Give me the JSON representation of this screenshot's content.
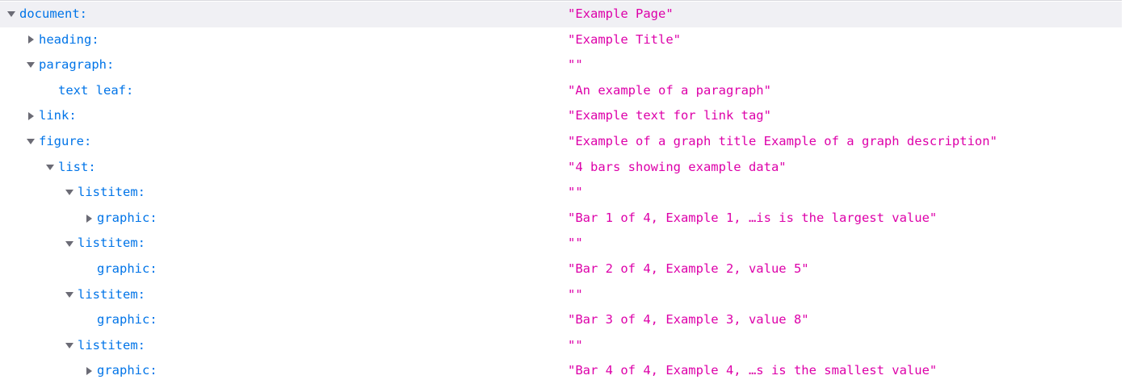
{
  "tree": {
    "rows": [
      {
        "name": "document:",
        "value": "\"Example Page\"",
        "icon": "expanded-triangle"
      },
      {
        "name": "heading:",
        "value": "\"Example Title\"",
        "icon": "collapsed-triangle"
      },
      {
        "name": "paragraph:",
        "value": "\"\"",
        "icon": "expanded-triangle"
      },
      {
        "name": "text leaf:",
        "value": "\"An example of a paragraph\"",
        "icon": "none"
      },
      {
        "name": "link:",
        "value": "\"Example text for link tag\"",
        "icon": "collapsed-triangle"
      },
      {
        "name": "figure:",
        "value": "\"Example of a graph title Example of a graph description\"",
        "icon": "expanded-triangle"
      },
      {
        "name": "list:",
        "value": "\"4 bars showing example data\"",
        "icon": "expanded-triangle"
      },
      {
        "name": "listitem:",
        "value": "\"\"",
        "icon": "expanded-triangle"
      },
      {
        "name": "graphic:",
        "value": "\"Bar 1 of 4,  Example 1, …is is the largest value\"",
        "icon": "collapsed-triangle"
      },
      {
        "name": "listitem:",
        "value": "\"\"",
        "icon": "expanded-triangle"
      },
      {
        "name": "graphic:",
        "value": "\"Bar 2 of 4,  Example 2, value 5\"",
        "icon": "none"
      },
      {
        "name": "listitem:",
        "value": "\"\"",
        "icon": "expanded-triangle"
      },
      {
        "name": "graphic:",
        "value": "\"Bar 3 of 4,  Example 3, value 8\"",
        "icon": "none"
      },
      {
        "name": "listitem:",
        "value": "\"\"",
        "icon": "expanded-triangle"
      },
      {
        "name": "graphic:",
        "value": "\"Bar 4 of 4,  Example 4, …s is the smallest value\"",
        "icon": "collapsed-triangle"
      }
    ]
  },
  "colors": {
    "name": "#0074e8",
    "value": "#dd00a9",
    "selected_row": "#f0f0f4",
    "twisty": "#6b6b75"
  }
}
